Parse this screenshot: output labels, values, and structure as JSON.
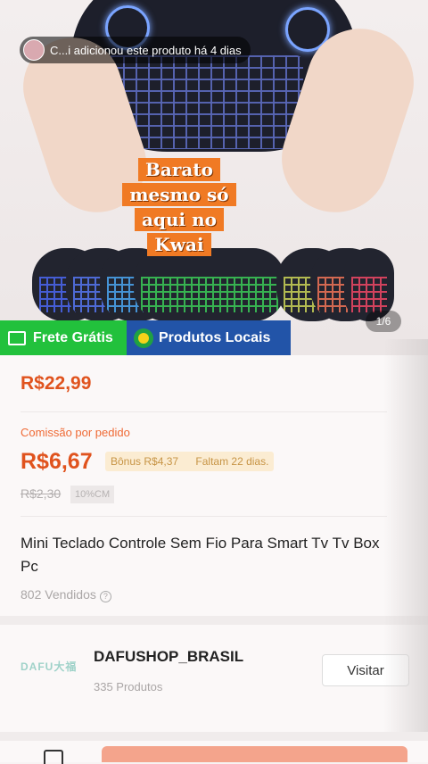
{
  "notification": {
    "text": "C...i adicionou este produto há 4 dias"
  },
  "hero": {
    "promo_lines": [
      "Barato",
      "mesmo só",
      "aqui no",
      "Kwai"
    ],
    "counter": "1/6"
  },
  "badges": {
    "free_shipping": "Frete Grátis",
    "local_products": "Produtos Locais"
  },
  "product": {
    "price": "R$22,99",
    "commission_label": "Comissão por pedido",
    "commission_value": "R$6,67",
    "bonus": "Bônus R$4,37",
    "time_left": "Faltam 22 dias.",
    "old_commission": "R$2,30",
    "commission_pct": "10%CM",
    "title": "Mini Teclado Controle Sem Fio Para Smart Tv Tv Box Pc",
    "sold": "802 Vendidos"
  },
  "shop": {
    "logo_text": "DAFU大福",
    "name": "DAFUSHOP_BRASIL",
    "products": "335 Produtos",
    "visit_label": "Visitar"
  },
  "colors": {
    "accent": "#e0531e",
    "free_shipping_bg": "#22c13c",
    "local_bg": "#2254a8",
    "promo_bg": "#f07a24"
  }
}
